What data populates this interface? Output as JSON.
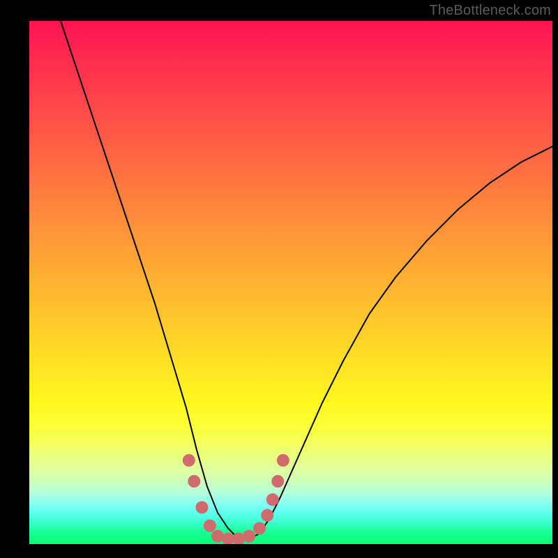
{
  "watermark": "TheBottleneck.com",
  "chart_data": {
    "type": "line",
    "title": "",
    "xlabel": "",
    "ylabel": "",
    "xlim": [
      0,
      100
    ],
    "ylim": [
      0,
      100
    ],
    "gradient_note": "Vertical gradient encodes bottleneck severity: red (top) high, green (bottom) low",
    "series": [
      {
        "name": "bottleneck-curve",
        "x": [
          6,
          10,
          15,
          20,
          24,
          27,
          30,
          32,
          34,
          36,
          38,
          40,
          42,
          44,
          46,
          48,
          52,
          56,
          60,
          65,
          70,
          76,
          82,
          88,
          94,
          100
        ],
        "y": [
          100,
          88,
          73,
          58,
          46,
          36,
          26,
          18,
          11,
          6,
          3,
          1,
          1,
          2,
          5,
          9,
          18,
          27,
          35,
          44,
          51,
          58,
          64,
          69,
          73,
          76
        ]
      }
    ],
    "markers": {
      "name": "highlight-dots",
      "color": "#d16a6d",
      "points": [
        {
          "x": 30.5,
          "y": 16
        },
        {
          "x": 31.5,
          "y": 12
        },
        {
          "x": 33,
          "y": 7
        },
        {
          "x": 34.5,
          "y": 3.5
        },
        {
          "x": 36,
          "y": 1.5
        },
        {
          "x": 38,
          "y": 1
        },
        {
          "x": 40,
          "y": 1
        },
        {
          "x": 42,
          "y": 1.5
        },
        {
          "x": 44,
          "y": 3
        },
        {
          "x": 45.5,
          "y": 5.5
        },
        {
          "x": 46.5,
          "y": 8.5
        },
        {
          "x": 47.5,
          "y": 12
        },
        {
          "x": 48.5,
          "y": 16
        }
      ]
    }
  }
}
